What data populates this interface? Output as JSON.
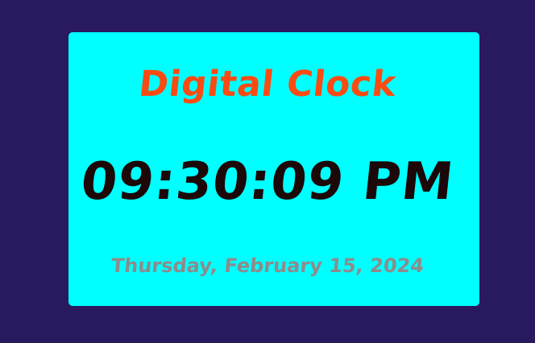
{
  "clock": {
    "title": "Digital Clock",
    "time": "09:30:09 PM",
    "date": "Thursday, February 15, 2024"
  },
  "colors": {
    "page_background": "#29195f",
    "card_background": "#00ffff",
    "title": "#fa4b12",
    "time": "#1c0808",
    "date": "#8c8c8c"
  }
}
